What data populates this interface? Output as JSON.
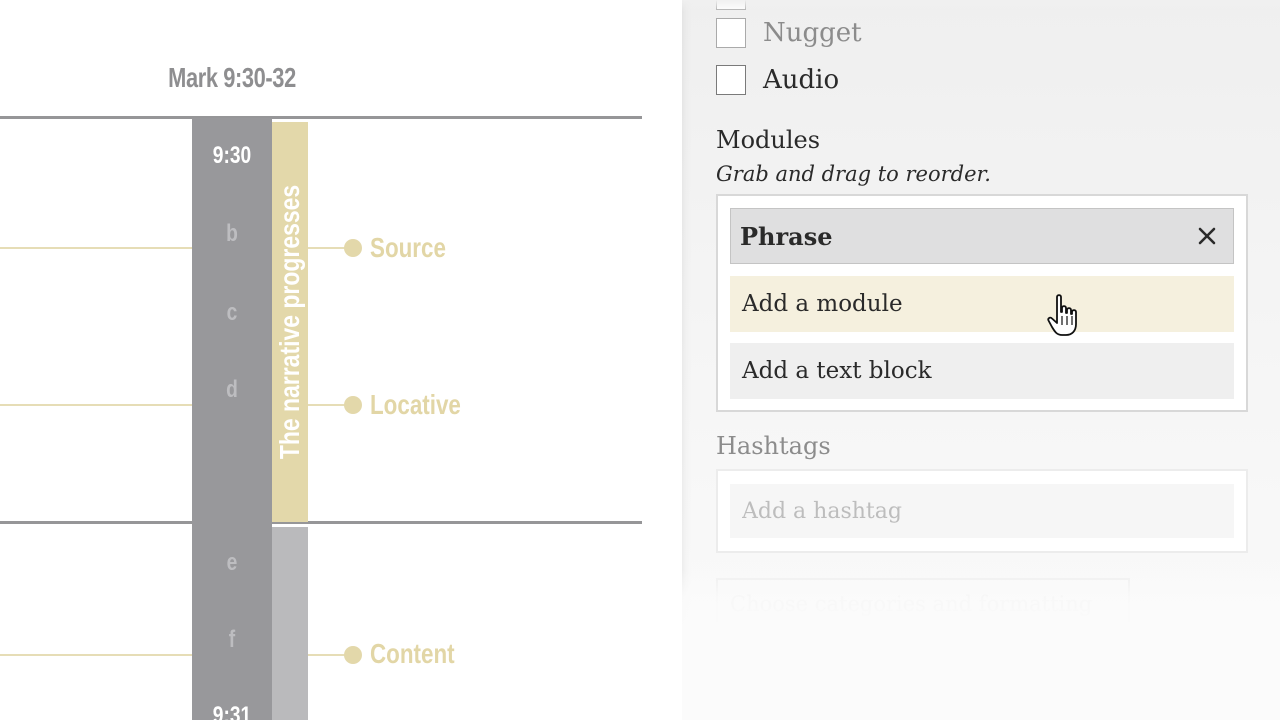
{
  "visualization": {
    "passage_title": "Mark 9:30-32",
    "verse_labels": [
      "9:30",
      "b",
      "c",
      "d",
      "e",
      "f",
      "9:31"
    ],
    "theme": "The narrative progresses",
    "tags": [
      "Source",
      "Locative",
      "Content"
    ]
  },
  "panel": {
    "checkboxes": [
      {
        "label": "Nugget",
        "checked": false
      },
      {
        "label": "Audio",
        "checked": false
      }
    ],
    "modules": {
      "title": "Modules",
      "hint": "Grab and drag to reorder.",
      "items": [
        {
          "label": "Phrase",
          "removable": true
        },
        {
          "label": "Add a module"
        },
        {
          "label": "Add a text block"
        }
      ]
    },
    "hashtags": {
      "title": "Hashtags",
      "placeholder": "Add a hashtag"
    },
    "faded_field_text": "Choose categories and formatting"
  },
  "colors": {
    "verse_column": "#98989b",
    "theme_bar": "#e3d8aa",
    "tag_label": "#e2d6a6",
    "add_module_highlight": "#f5f0de"
  },
  "icons": {
    "remove": "close-icon",
    "cursor": "hand-pointer-cursor"
  }
}
